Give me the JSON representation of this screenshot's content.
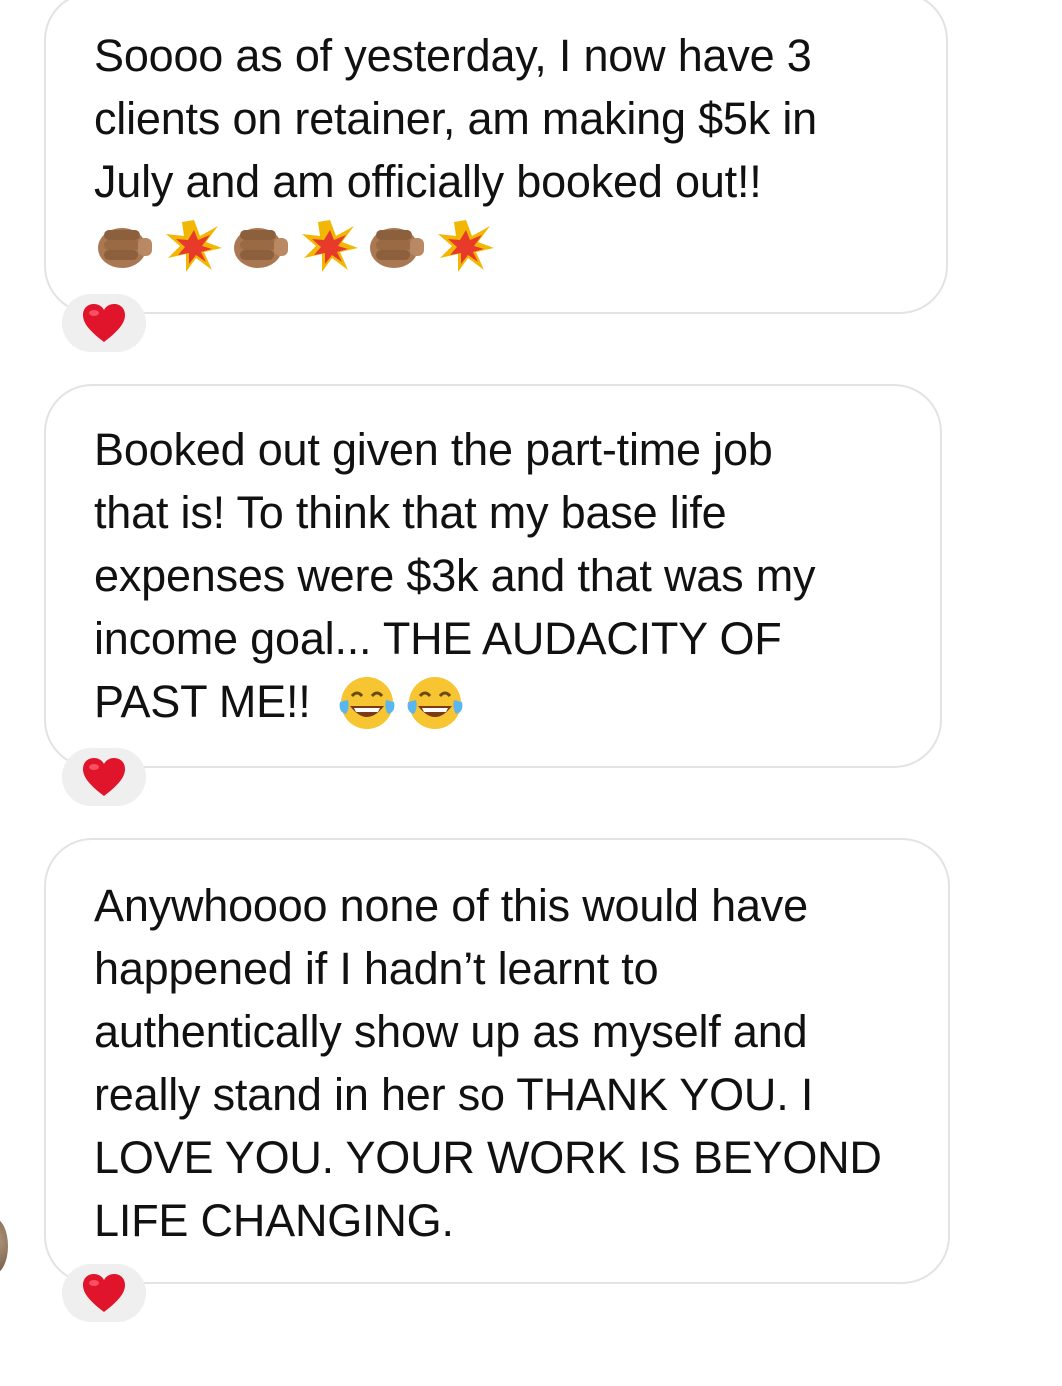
{
  "thread": {
    "messages": [
      {
        "text": "Soooo as of yesterday, I now have 3\nclients on retainer, am making $5k in\nJuly and am officially booked out!!",
        "emojis": [
          "fist-bump-emoji",
          "collision-emoji",
          "fist-bump-emoji",
          "collision-emoji",
          "fist-bump-emoji",
          "collision-emoji"
        ],
        "reaction": "heart-emoji"
      },
      {
        "text": "Booked out given the part-time job\nthat is! To think that my base life\nexpenses were $3k and that was my\nincome goal... THE AUDACITY OF\nPAST ME!!",
        "emojis": [
          "tears-of-joy-emoji",
          "tears-of-joy-emoji"
        ],
        "reaction": "heart-emoji"
      },
      {
        "text": "Anywhoooo none of this would have\nhappened if I hadn’t learnt to\nauthentically show up as myself and\nreally stand in her so THANK YOU. I\nLOVE YOU. YOUR WORK IS BEYOND\nLIFE CHANGING.",
        "emojis": [],
        "reaction": "heart-emoji"
      }
    ]
  },
  "colors": {
    "bubble_border": "#e3e3e3",
    "reaction_bg": "#efefef",
    "heart": "#e0142a",
    "text": "#111111"
  }
}
